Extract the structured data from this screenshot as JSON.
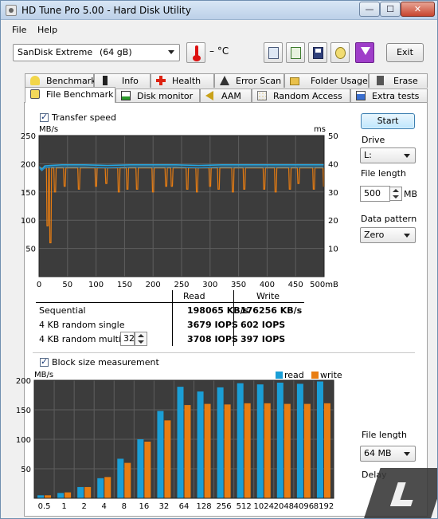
{
  "window": {
    "title": "HD Tune Pro 5.00 - Hard Disk Utility",
    "minimize": "—",
    "maximize": "☐",
    "close": "✕"
  },
  "menu": {
    "file": "File",
    "help": "Help"
  },
  "toolbar": {
    "drive_name": "SanDisk Extreme",
    "drive_size": "(64 gB)",
    "temperature": "– °C",
    "exit": "Exit"
  },
  "tabs_top": [
    {
      "label": "Benchmark",
      "icon": "benchmark-icon"
    },
    {
      "label": "Info",
      "icon": "info-icon"
    },
    {
      "label": "Health",
      "icon": "health-cross-icon"
    },
    {
      "label": "Error Scan",
      "icon": "error-scan-icon"
    },
    {
      "label": "Folder Usage",
      "icon": "folder-icon"
    },
    {
      "label": "Erase",
      "icon": "erase-trash-icon"
    }
  ],
  "tabs_bottom": [
    {
      "label": "File Benchmark",
      "icon": "file-benchmark-icon",
      "active": true
    },
    {
      "label": "Disk monitor",
      "icon": "disk-monitor-icon"
    },
    {
      "label": "AAM",
      "icon": "speaker-icon"
    },
    {
      "label": "Random Access",
      "icon": "random-access-icon"
    },
    {
      "label": "Extra tests",
      "icon": "extra-tests-icon"
    }
  ],
  "transfer": {
    "checkbox_label": "Transfer speed",
    "left_unit": "MB/s",
    "right_unit": "ms"
  },
  "side": {
    "start": "Start",
    "drive_label": "Drive",
    "drive_value": "L:",
    "file_length_label": "File length",
    "file_length_value": "500",
    "file_length_unit": "MB",
    "data_pattern_label": "Data pattern",
    "data_pattern_value": "Zero",
    "file_length2_label": "File length",
    "file_length2_value": "64 MB",
    "delay_label": "Delay"
  },
  "stats": {
    "col_read": "Read",
    "col_write": "Write",
    "rows": [
      {
        "label": "Sequential",
        "read": "198065 KB/s",
        "write": "176256 KB/s"
      },
      {
        "label": "4 KB random single",
        "read": "3679 IOPS",
        "write": "602 IOPS"
      },
      {
        "label": "4 KB random multi",
        "read": "3708 IOPS",
        "write": "397 IOPS"
      }
    ],
    "multi_value": "32"
  },
  "block": {
    "checkbox_label": "Block size measurement",
    "unit": "MB/s",
    "legend_read": "read",
    "legend_write": "write"
  },
  "colors": {
    "read": "#1a9ed6",
    "write": "#e87d12",
    "chart_bg": "#3c3c3c",
    "grid": "#5e5e5e"
  },
  "chart_data": [
    {
      "type": "line",
      "title": "Transfer speed",
      "ylabel": "MB/s",
      "y2label": "ms",
      "ylim": [
        0,
        250
      ],
      "y2lim": [
        0,
        50
      ],
      "x_ticks": [
        "0",
        "50",
        "100",
        "150",
        "200",
        "250",
        "300",
        "350",
        "400",
        "450",
        "500mB"
      ],
      "y_ticks": [
        "250",
        "200",
        "150",
        "100",
        "50"
      ],
      "y2_ticks": [
        "50",
        "40",
        "30",
        "20",
        "10"
      ],
      "series": [
        {
          "name": "read",
          "axis": "left",
          "x": [
            0,
            5,
            10,
            20,
            40,
            80,
            120,
            160,
            200,
            240,
            280,
            320,
            360,
            400,
            440,
            480,
            500
          ],
          "values": [
            195,
            190,
            196,
            197,
            198,
            198,
            197,
            198,
            198,
            198,
            197,
            198,
            198,
            198,
            198,
            198,
            198
          ]
        },
        {
          "name": "write",
          "axis": "left",
          "x": [
            0,
            5,
            10,
            20,
            40,
            80,
            120,
            160,
            200,
            240,
            280,
            320,
            360,
            400,
            440,
            480,
            500
          ],
          "values": [
            193,
            188,
            193,
            194,
            194,
            194,
            193,
            194,
            194,
            194,
            193,
            194,
            194,
            194,
            194,
            194,
            194
          ]
        },
        {
          "name": "access",
          "axis": "right",
          "baseline": 38.5,
          "dips_x": [
            15,
            20,
            28,
            45,
            70,
            100,
            118,
            140,
            155,
            172,
            200,
            223,
            233,
            260,
            277,
            300,
            315,
            340,
            360,
            395,
            415,
            440,
            455,
            482,
            500
          ],
          "dips_values": [
            18,
            12,
            30,
            32,
            31,
            32,
            33,
            30,
            31,
            31,
            30,
            32,
            32,
            31,
            30,
            32,
            31,
            30,
            31,
            31,
            30,
            31,
            33,
            31,
            32
          ]
        }
      ]
    },
    {
      "type": "bar",
      "title": "Block size measurement",
      "ylabel": "MB/s",
      "ylim": [
        0,
        200
      ],
      "y_ticks": [
        "200",
        "150",
        "100",
        "50"
      ],
      "categories": [
        "0.5",
        "1",
        "2",
        "4",
        "8",
        "16",
        "32",
        "64",
        "128",
        "256",
        "512",
        "1024",
        "2048",
        "4096",
        "8192"
      ],
      "series": [
        {
          "name": "read",
          "values": [
            5,
            9,
            19,
            34,
            67,
            100,
            148,
            189,
            181,
            188,
            195,
            193,
            196,
            194,
            198
          ]
        },
        {
          "name": "write",
          "values": [
            5,
            10,
            19,
            36,
            60,
            96,
            132,
            158,
            160,
            159,
            161,
            161,
            160,
            160,
            161
          ]
        }
      ]
    }
  ]
}
